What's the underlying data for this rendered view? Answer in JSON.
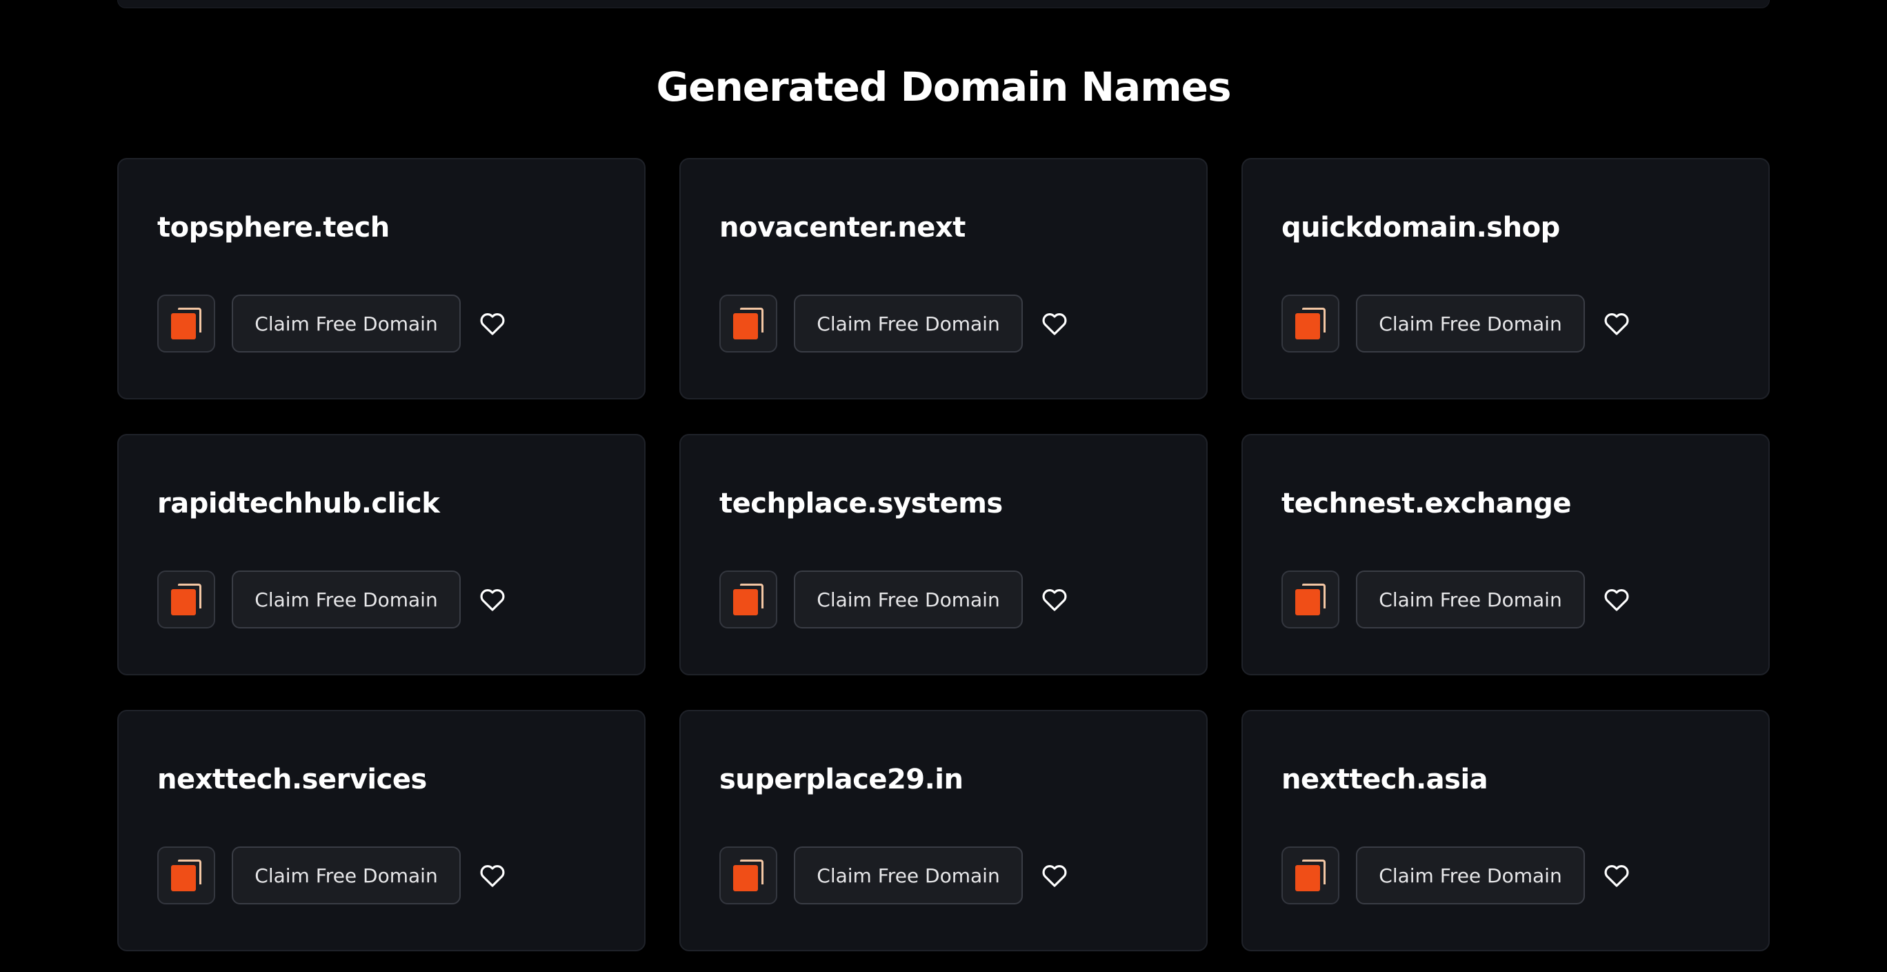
{
  "section": {
    "title": "Generated Domain Names"
  },
  "cards": [
    {
      "domain": "topsphere.tech",
      "claim_label": "Claim Free Domain"
    },
    {
      "domain": "novacenter.next",
      "claim_label": "Claim Free Domain"
    },
    {
      "domain": "quickdomain.shop",
      "claim_label": "Claim Free Domain"
    },
    {
      "domain": "rapidtechhub.click",
      "claim_label": "Claim Free Domain"
    },
    {
      "domain": "techplace.systems",
      "claim_label": "Claim Free Domain"
    },
    {
      "domain": "technest.exchange",
      "claim_label": "Claim Free Domain"
    },
    {
      "domain": "nexttech.services",
      "claim_label": "Claim Free Domain"
    },
    {
      "domain": "superplace29.in",
      "claim_label": "Claim Free Domain"
    },
    {
      "domain": "nexttech.asia",
      "claim_label": "Claim Free Domain"
    }
  ],
  "icons": {
    "copy": "copy-icon",
    "favorite": "heart-icon"
  },
  "colors": {
    "background": "#000000",
    "card": "#111318",
    "accent": "#f04e17",
    "accent_light": "#f4c7a4"
  }
}
